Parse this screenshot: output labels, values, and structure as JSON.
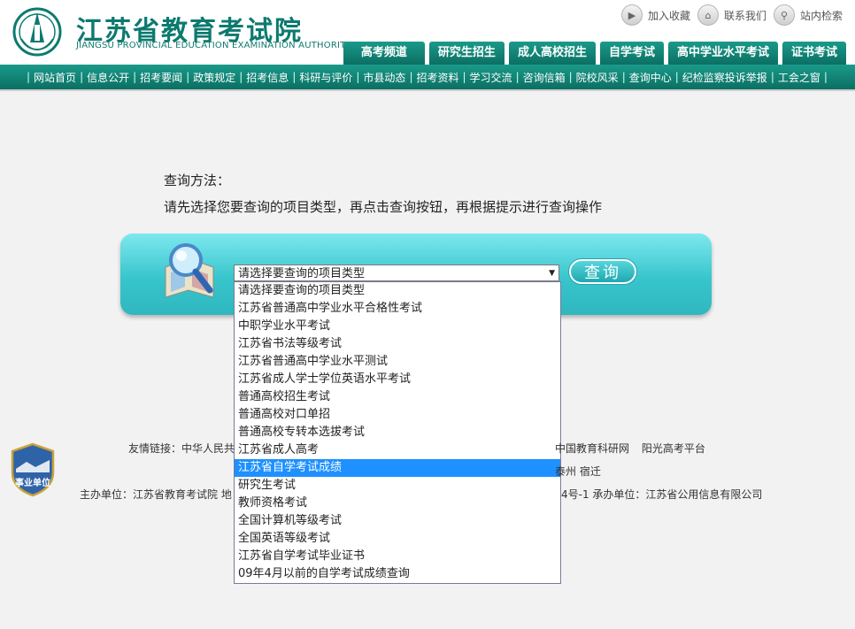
{
  "header": {
    "logo_cn": "江苏省教育考试院",
    "logo_en": "JIANGSU PROVINCIAL EDUCATION EXAMINATION AUTHORITY",
    "toplinks": [
      "加入收藏",
      "联系我们",
      "站内检索"
    ],
    "tabs": [
      "高考频道",
      "研究生招生",
      "成人高校招生",
      "自学考试",
      "高中学业水平考试",
      "证书考试"
    ]
  },
  "nav": [
    "网站首页",
    "信息公开",
    "招考要闻",
    "政策规定",
    "招考信息",
    "科研与评价",
    "市县动态",
    "招考资料",
    "学习交流",
    "咨询信箱",
    "院校风采",
    "查询中心",
    "纪检监察投诉举报",
    "工会之窗"
  ],
  "instructions": {
    "title": "查询方法：",
    "text": "请先选择您要查询的项目类型，再点击查询按钮，再根据提示进行查询操作"
  },
  "query": {
    "select_value": "请选择要查询的项目类型",
    "button_label": "查询",
    "options": [
      "请选择要查询的项目类型",
      "江苏省普通高中学业水平合格性考试",
      "中职学业水平考试",
      "江苏省书法等级考试",
      "江苏省普通高中学业水平测试",
      "江苏省成人学士学位英语水平考试",
      "普通高校招生考试",
      "普通高校对口单招",
      "普通高校专转本选拔考试",
      "江苏省成人高考",
      "江苏省自学考试成绩",
      "研究生考试",
      "教师资格考试",
      "全国计算机等级考试",
      "全国英语等级考试",
      "江苏省自学考试毕业证书",
      "09年4月以前的自学考试成绩查询"
    ],
    "highlighted_index": 10
  },
  "footer": {
    "badge_text": "事业单位",
    "links_prefix": "友情链接：中华人民共",
    "links_right": [
      "中国教育科研网",
      "阳光高考平台"
    ],
    "cities_right": "泰州  宿迁",
    "host_left": "主办单位：江苏省教育考试院  地",
    "host_right": "4号-1  承办单位：江苏省公用信息有限公司"
  }
}
